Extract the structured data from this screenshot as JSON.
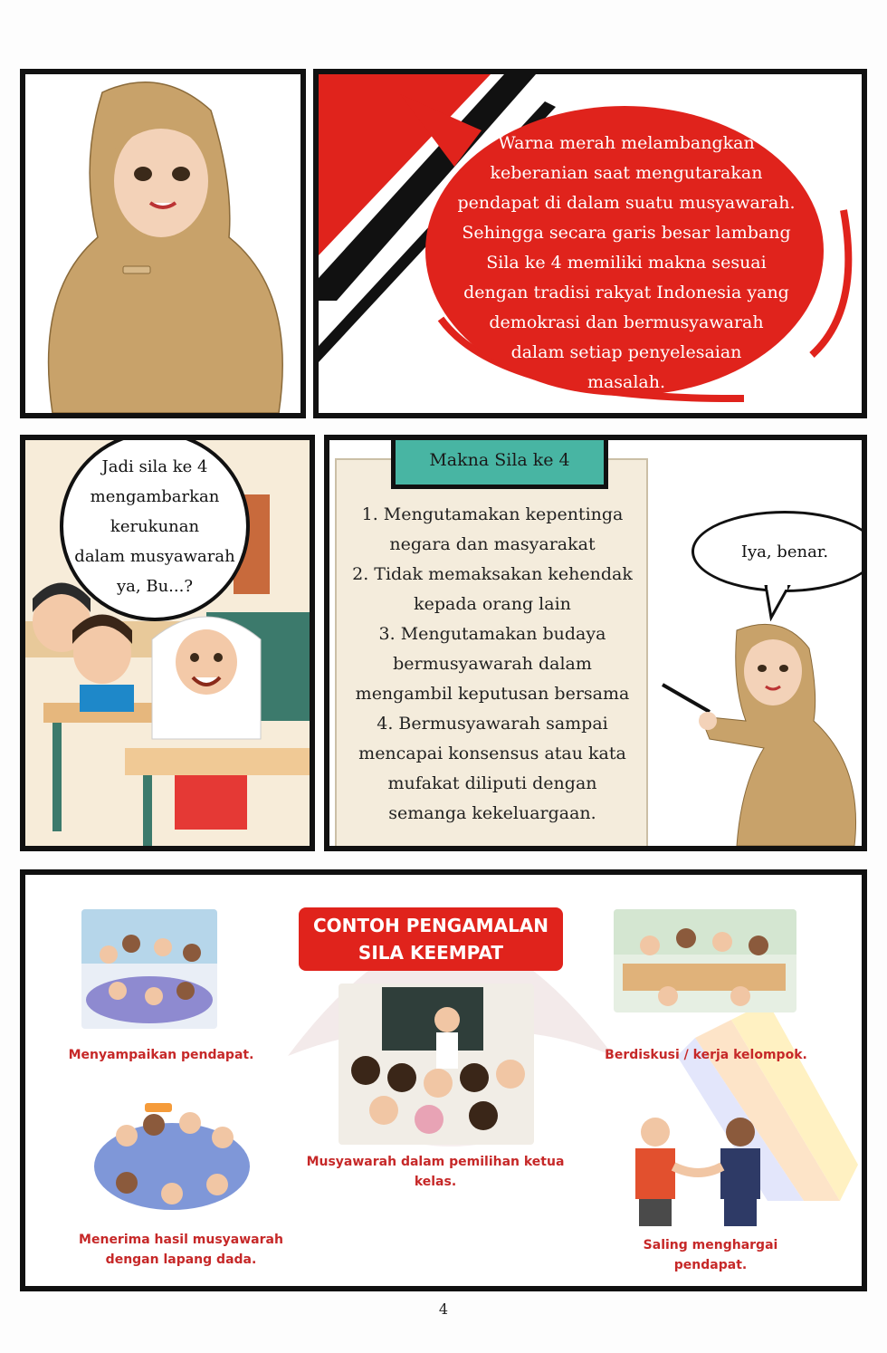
{
  "panel1": {},
  "panel2": {
    "speech_lines": [
      "Warna merah melambangkan",
      "keberanian saat mengutarakan",
      "pendapat di dalam suatu musyawarah.",
      "Sehingga secara garis besar lambang",
      "Sila ke 4 memiliki makna sesuai",
      "dengan tradisi rakyat Indonesia yang",
      "demokrasi dan bermusyawarah",
      "dalam setiap penyelesaian",
      "masalah."
    ],
    "accent_color": "#e0231c"
  },
  "panel3": {
    "question_lines": [
      "Jadi sila ke 4",
      "mengambarkan",
      "kerukunan",
      "dalam musyawarah",
      "ya, Bu...?"
    ]
  },
  "panel4": {
    "board_title": "Makna Sila ke 4",
    "list_lines": [
      "1. Mengutamakan kepentinga",
      "negara dan masyarakat",
      "2. Tidak memaksakan kehendak",
      "kepada orang lain",
      "3. Mengutamakan budaya",
      "bermusyawarah dalam",
      "mengambil keputusan bersama",
      "4. Bermusyawarah sampai",
      "mencapai konsensus atau kata",
      "mufakat diliputi dengan",
      "semanga kekeluargaan."
    ],
    "teacher_reply": "Iya, benar."
  },
  "panel5": {
    "banner_line1": "CONTOH PENGAMALAN",
    "banner_line2": "SILA KEEMPAT",
    "captions": {
      "top_left": "Menyampaikan pendapat.",
      "top_right": "Berdiskusi / kerja kelompok.",
      "center": "Musyawarah dalam pemilihan ketua kelas.",
      "bottom_left": "Menerima hasil musyawarah dengan lapang dada.",
      "bottom_right": "Saling menghargai pendapat."
    }
  },
  "page_number": "4",
  "colors": {
    "hijab": "#c8a26a",
    "teal": "#48b5a3",
    "red": "#e0231c",
    "paper": "#f4ecdc"
  }
}
